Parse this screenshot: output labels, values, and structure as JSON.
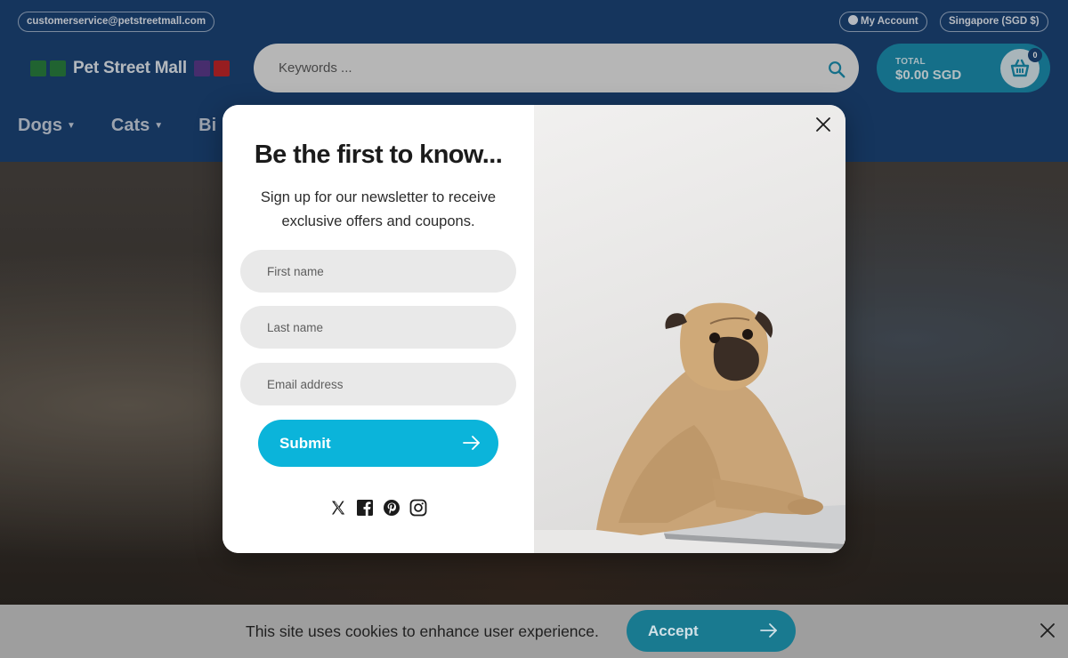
{
  "header": {
    "email": "customerservice@petstreetmall.com",
    "account_label": "My Account",
    "currency_label": "Singapore (SGD $)",
    "logo_text": "Pet Street Mall",
    "search_placeholder": "Keywords ...",
    "cart": {
      "total_label": "TOTAL",
      "total_value": "$0.00 SGD",
      "count": "0"
    },
    "nav": [
      {
        "label": "Dogs"
      },
      {
        "label": "Cats"
      },
      {
        "label": "Bi"
      }
    ]
  },
  "modal": {
    "title": "Be the first to know...",
    "subtitle": "Sign up for our newsletter to receive exclusive offers and coupons.",
    "fields": {
      "first_name_placeholder": "First name",
      "last_name_placeholder": "Last name",
      "email_placeholder": "Email address"
    },
    "submit_label": "Submit",
    "socials": [
      "x-icon",
      "facebook-icon",
      "pinterest-icon",
      "instagram-icon"
    ]
  },
  "cookie_bar": {
    "text": "This site uses cookies to enhance user experience.",
    "accept_label": "Accept"
  },
  "colors": {
    "header_bg": "#1c4478",
    "accent": "#0bb4da",
    "cart_bg": "#1b8fb0",
    "cookie_bg": "#9e9e9e"
  }
}
